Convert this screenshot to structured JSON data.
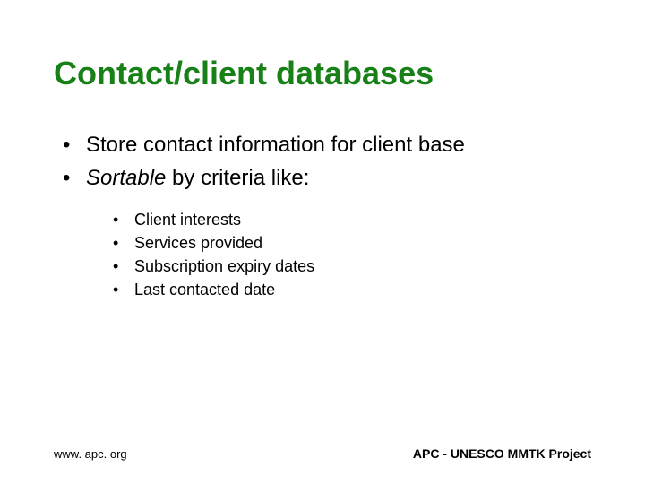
{
  "title": "Contact/client databases",
  "bullets": {
    "b1": "Store contact information for client base",
    "b2_prefix": "Sortable",
    "b2_suffix": " by criteria like:"
  },
  "sub": {
    "s1": "Client interests",
    "s2": "Services provided",
    "s3": "Subscription expiry dates",
    "s4": "Last contacted date"
  },
  "footer": {
    "left": "www. apc. org",
    "right": "APC - UNESCO MMTK Project"
  }
}
